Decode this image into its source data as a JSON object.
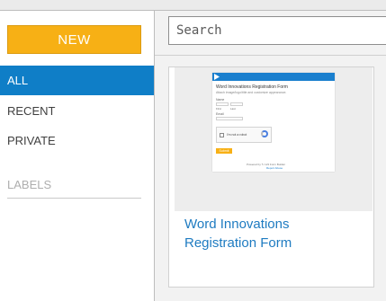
{
  "sidebar": {
    "new_button": "NEW",
    "nav": [
      {
        "label": "ALL",
        "active": true
      },
      {
        "label": "RECENT",
        "active": false
      },
      {
        "label": "PRIVATE",
        "active": false
      }
    ],
    "labels_title": "LABELS"
  },
  "search": {
    "placeholder": "Search",
    "value": ""
  },
  "forms": [
    {
      "title": "Word Innovations Registration Form",
      "thumbnail": {
        "title": "Word Innovations Registration Form",
        "subtitle": "Attach image/logo/title and customize appearance.",
        "field_labels": [
          "Name",
          "Email"
        ],
        "name_sublabels": [
          "First",
          "Last"
        ],
        "captcha_label": "I'm not a robot",
        "submit_label": "Submit",
        "powered_by": "Powered by ✎ 123 Form Builder",
        "footer_link": "Report Abuse"
      }
    }
  ],
  "colors": {
    "accent": "#0f7ec7",
    "new_button": "#f7b015",
    "card_title": "#1e7bc1"
  }
}
